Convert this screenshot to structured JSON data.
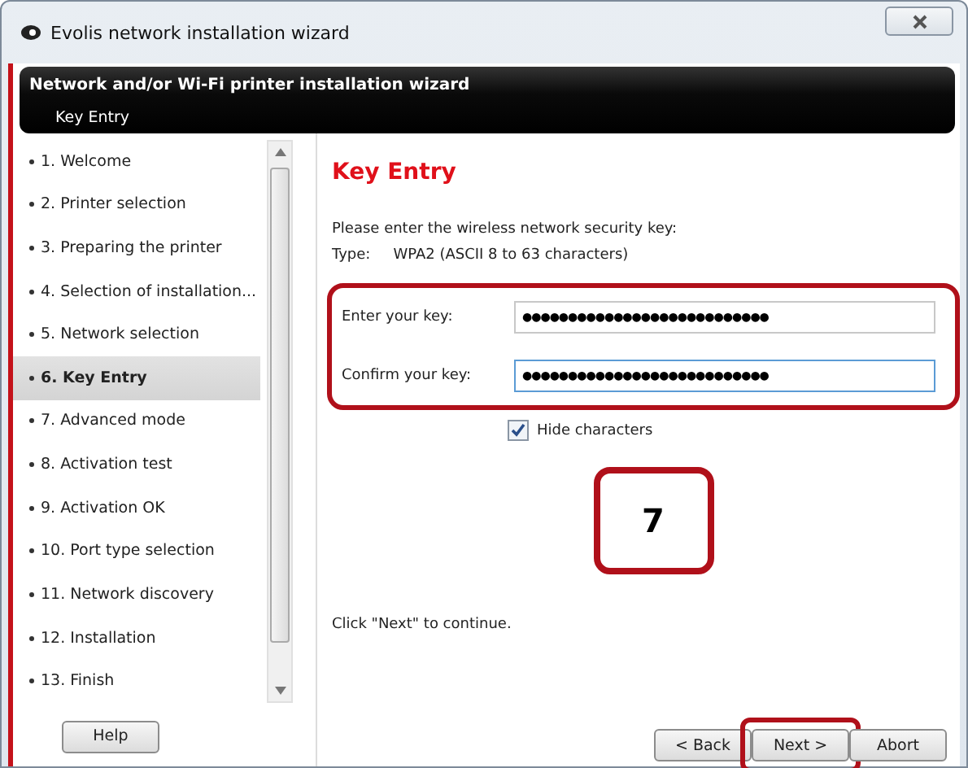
{
  "window": {
    "title": "Evolis network installation wizard"
  },
  "header": {
    "title": "Network and/or Wi-Fi printer installation wizard",
    "subtitle": "Key Entry"
  },
  "steps": [
    {
      "label": "1. Welcome",
      "selected": false
    },
    {
      "label": "2. Printer selection",
      "selected": false
    },
    {
      "label": "3. Preparing the printer",
      "selected": false
    },
    {
      "label": "4. Selection of installation...",
      "selected": false
    },
    {
      "label": "5. Network selection",
      "selected": false
    },
    {
      "label": "6. Key Entry",
      "selected": true
    },
    {
      "label": "7. Advanced mode",
      "selected": false
    },
    {
      "label": "8. Activation test",
      "selected": false
    },
    {
      "label": "9. Activation OK",
      "selected": false
    },
    {
      "label": "10. Port type selection",
      "selected": false
    },
    {
      "label": "11. Network discovery",
      "selected": false
    },
    {
      "label": "12. Installation",
      "selected": false
    },
    {
      "label": "13. Finish",
      "selected": false
    }
  ],
  "help_button": "Help",
  "page": {
    "title": "Key Entry",
    "instruction": "Please enter the wireless network security key:",
    "type_label": "Type:",
    "type_value": "WPA2 (ASCII  8 to 63 characters)",
    "key_group": {
      "highlighted": true,
      "fields": [
        {
          "label": "Enter your key:",
          "value": "●●●●●●●●●●●●●●●●●●●●●●●●●●●",
          "focused": false
        },
        {
          "label": "Confirm your key:",
          "value": "●●●●●●●●●●●●●●●●●●●●●●●●●●●",
          "focused": true
        }
      ]
    },
    "hide_characters": {
      "label": "Hide characters",
      "checked": true
    },
    "callout": "7",
    "footer_text": "Click \"Next\" to continue."
  },
  "buttons": [
    {
      "label": "< Back",
      "highlighted": false
    },
    {
      "label": "Next >",
      "highlighted": true
    },
    {
      "label": "Abort",
      "highlighted": false
    }
  ]
}
